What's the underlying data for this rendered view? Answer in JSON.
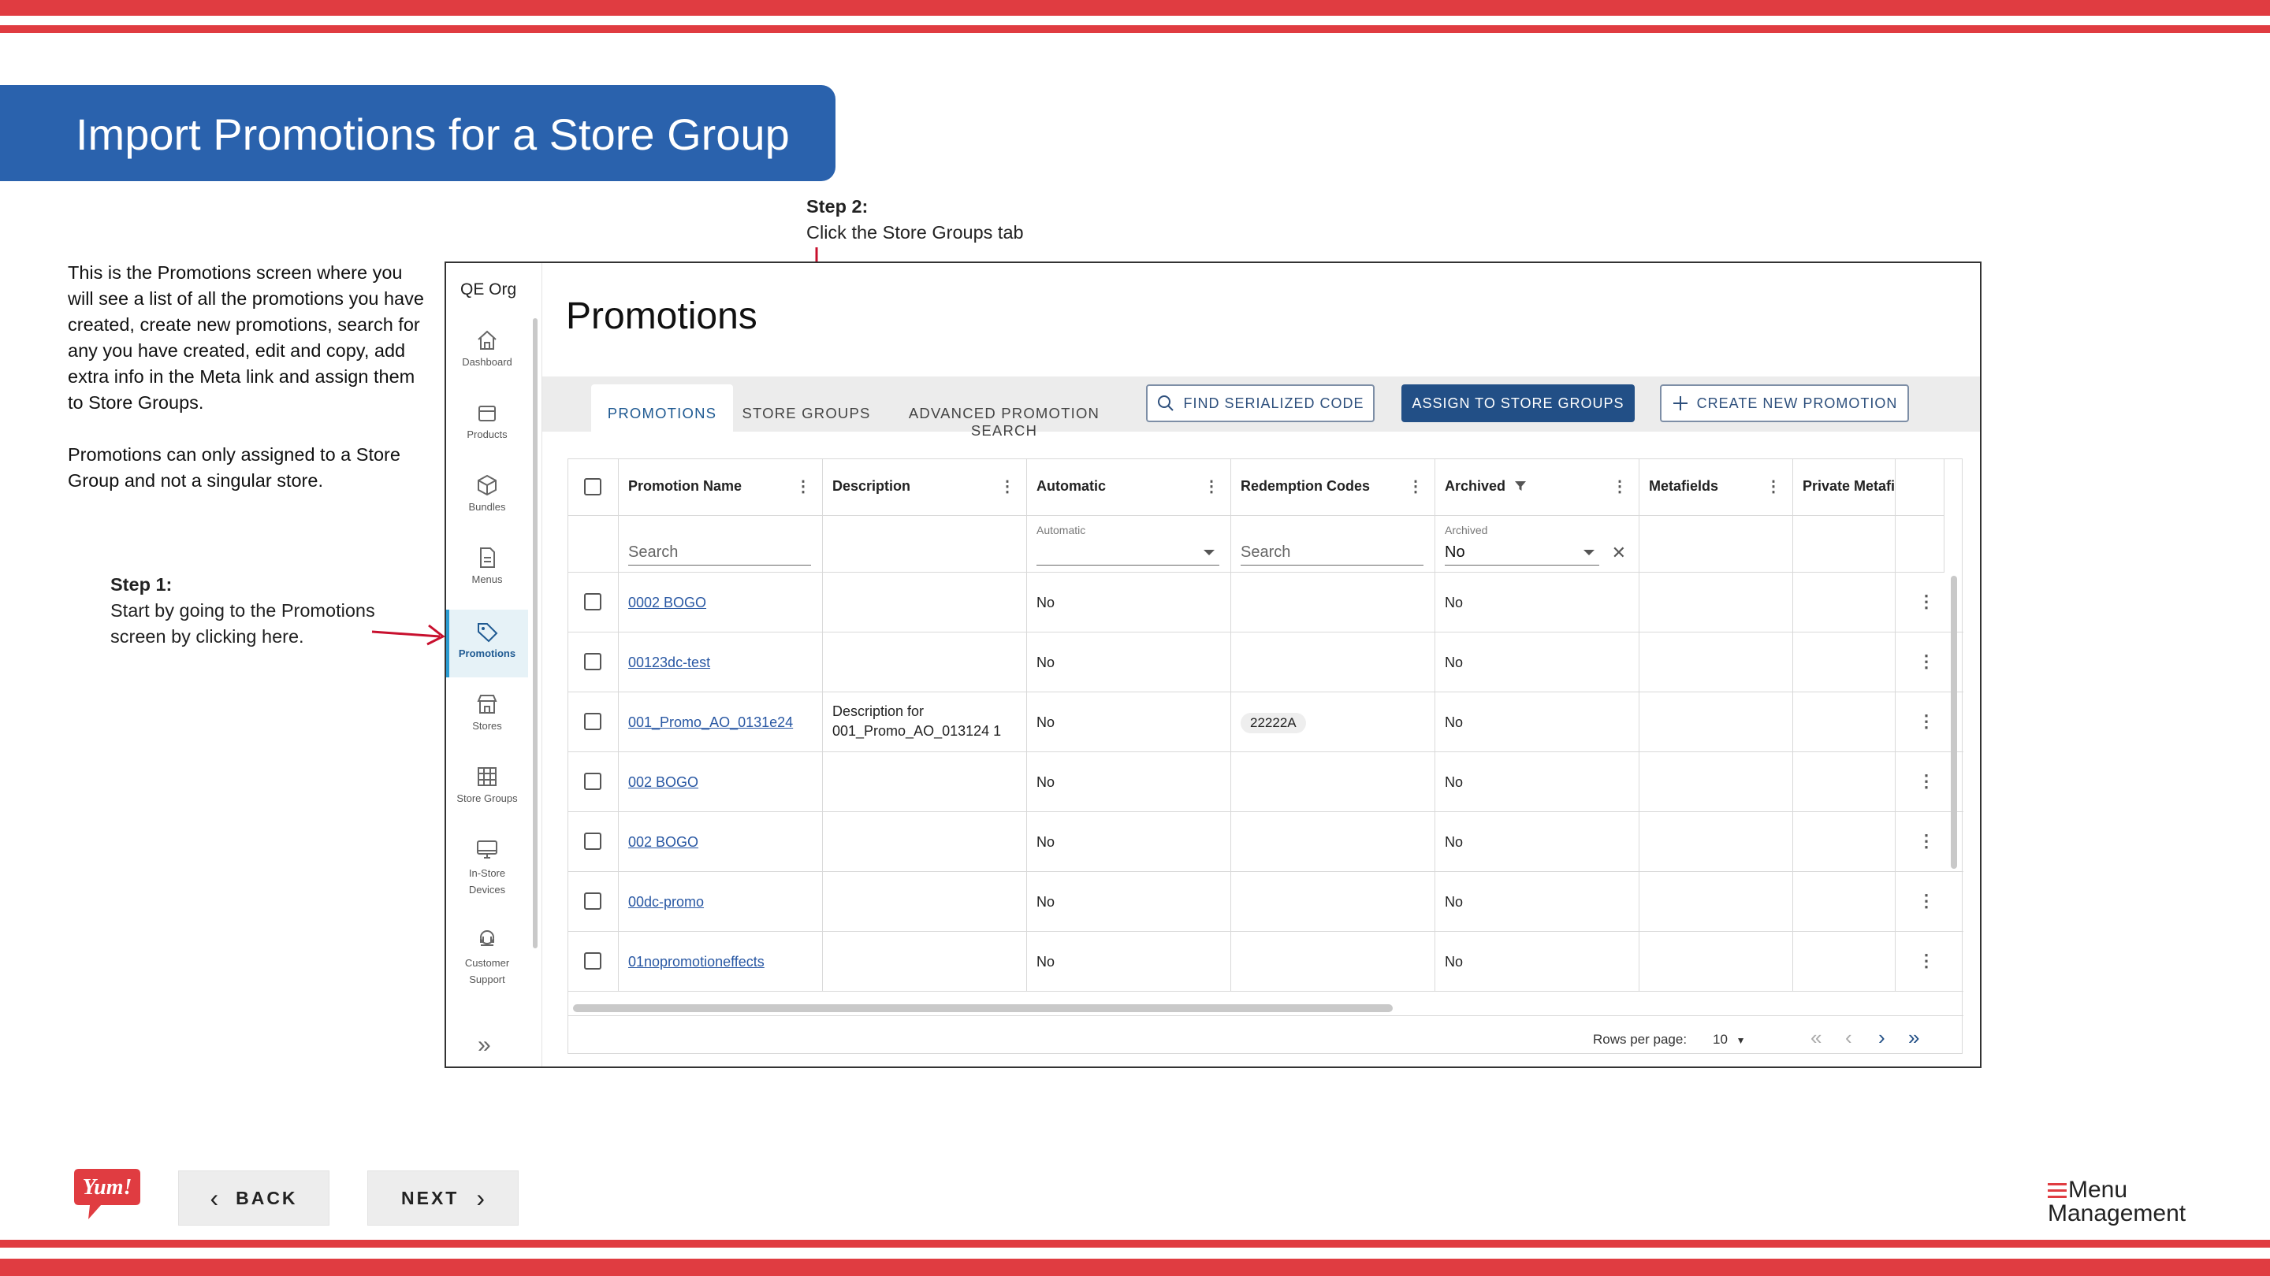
{
  "slide": {
    "title": "Import Promotions for a Store Group",
    "intro": [
      "This is the Promotions screen where you will see a list of all the promotions you have created, create new promotions, search for any you have created, edit and copy, add extra info in the Meta link and assign them to Store Groups.",
      "Promotions can only assigned to a Store Group and not a singular store."
    ],
    "step1": {
      "title": "Step 1:",
      "text": "Start by going to the Promotions screen by clicking here."
    },
    "step2": {
      "title": "Step 2:",
      "text": "Click the Store Groups tab"
    },
    "back_label": "BACK",
    "next_label": "NEXT",
    "logo_text": "Yum!",
    "brand_line1": "Menu",
    "brand_line2": "Management",
    "colors": {
      "stripe": "#e03c41",
      "banner": "#2a62ad",
      "primary": "#224f86",
      "arrow": "#c8102e"
    }
  },
  "app": {
    "org": "QE Org",
    "nav": [
      {
        "label": "Dashboard",
        "icon": "home-icon"
      },
      {
        "label": "Products",
        "icon": "box-icon"
      },
      {
        "label": "Bundles",
        "icon": "cube-icon"
      },
      {
        "label": "Menus",
        "icon": "menu-file-icon"
      },
      {
        "label": "Promotions",
        "icon": "tag-icon",
        "active": true
      },
      {
        "label": "Stores",
        "icon": "store-icon"
      },
      {
        "label": "Store Groups",
        "icon": "grid-icon"
      },
      {
        "label": "In-Store Devices",
        "icon": "monitor-icon"
      },
      {
        "label": "Customer Support",
        "icon": "headset-icon"
      }
    ],
    "page_title": "Promotions",
    "tabs": [
      "PROMOTIONS",
      "STORE GROUPS",
      "ADVANCED PROMOTION SEARCH"
    ],
    "buttons": {
      "find": "FIND SERIALIZED CODE",
      "assign": "ASSIGN TO STORE GROUPS",
      "create": "CREATE NEW PROMOTION"
    },
    "columns": [
      "Promotion Name",
      "Description",
      "Automatic",
      "Redemption Codes",
      "Archived",
      "Metafields",
      "Private Metafi"
    ],
    "filters": {
      "name_placeholder": "Search",
      "automatic_label": "Automatic",
      "codes_placeholder": "Search",
      "archived_label": "Archived",
      "archived_value": "No"
    },
    "rows": [
      {
        "name": "0002 BOGO",
        "description": "",
        "automatic": "No",
        "code": "",
        "archived": "No"
      },
      {
        "name": "00123dc-test",
        "description": "",
        "automatic": "No",
        "code": "",
        "archived": "No"
      },
      {
        "name": "001_Promo_AO_0131e24",
        "description": "Description for 001_Promo_AO_013124 1",
        "automatic": "No",
        "code": "22222A",
        "archived": "No"
      },
      {
        "name": "002 BOGO",
        "description": "",
        "automatic": "No",
        "code": "",
        "archived": "No"
      },
      {
        "name": "002 BOGO",
        "description": "",
        "automatic": "No",
        "code": "",
        "archived": "No"
      },
      {
        "name": "00dc-promo",
        "description": "",
        "automatic": "No",
        "code": "",
        "archived": "No"
      },
      {
        "name": "01nopromotioneffects",
        "description": "",
        "automatic": "No",
        "code": "",
        "archived": "No"
      }
    ],
    "pagination": {
      "rows_label": "Rows per page:",
      "rows_value": "10"
    }
  }
}
